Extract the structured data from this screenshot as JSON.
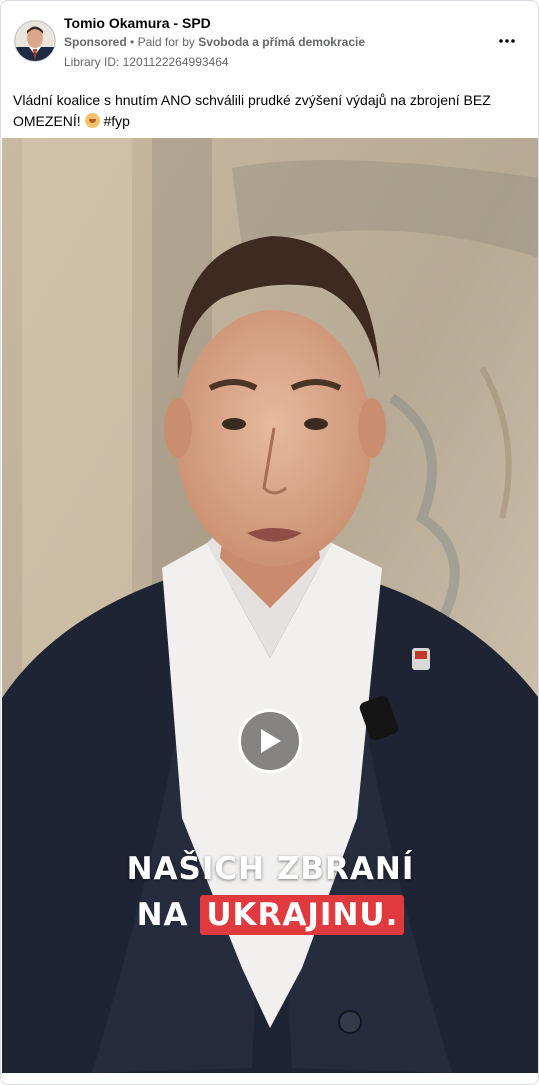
{
  "post": {
    "page_name": "Tomio Okamura - SPD",
    "sponsored_label": "Sponsored",
    "separator": "•",
    "paid_for_prefix": "Paid for by",
    "payer": "Svoboda a přímá demokracie",
    "library_id": "Library ID: 1201122264993464",
    "text": "Vládní koalice s hnutím ANO schválili prudké zvýšení výdajů na zbrojení BEZ OMEZENÍ!",
    "hashtag": "#fyp",
    "more_icon": "more-horizontal-icon"
  },
  "video": {
    "caption_line1": "NAŠICH ZBRANÍ",
    "caption_line2_prefix": "NA",
    "caption_line2_highlight": "UKRAJINU.",
    "highlight_color": "#e03a3e",
    "play_icon": "play-icon"
  },
  "colors": {
    "text_primary": "#050505",
    "text_secondary": "#65676b",
    "border": "#dadde1"
  }
}
